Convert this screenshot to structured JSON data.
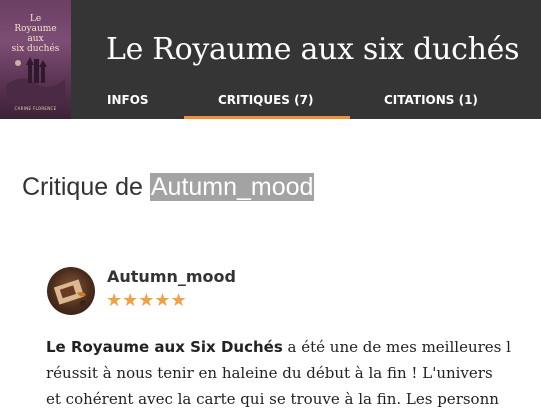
{
  "book": {
    "title": "Le Royaume aux six duchés",
    "cover_title": "Le\nRoyaume\naux\nsix duchés",
    "cover_author": "CARINE FLORENCE"
  },
  "tabs": [
    {
      "label": "INFOS"
    },
    {
      "label": "CRITIQUES (7)",
      "active": true
    },
    {
      "label": "CITATIONS (1)"
    }
  ],
  "colors": {
    "header_bg": "#353535",
    "accent": "#ef8e3b",
    "stars": "#f0a046",
    "highlight": "#a3a3a3"
  },
  "page": {
    "heading_prefix": "Critique de ",
    "heading_user": "Autumn_mood"
  },
  "review": {
    "username": "Autumn_mood",
    "rating": 5,
    "stars_text": "★★★★★",
    "bold_title": "Le Royaume aux Six Duchés",
    "line1_rest": " a été une de mes meilleures l",
    "line2": "réussit à nous tenir en haleine du début à la fin ! L'univers",
    "line3": "et cohérent avec la carte qui se trouve à la fin. Les personn"
  }
}
